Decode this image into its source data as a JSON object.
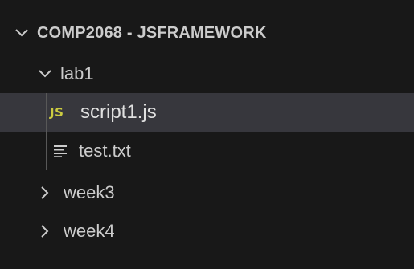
{
  "explorer": {
    "root": {
      "label": "COMP2068 - JSFRAMEWORK",
      "expanded": true,
      "icon": "chevron-down-icon"
    },
    "folder_lab1": {
      "label": "lab1",
      "expanded": true,
      "icon": "chevron-down-icon"
    },
    "file_script": {
      "label": "script1.js",
      "icon_text": "JS",
      "icon": "javascript-file-icon",
      "icon_color": "#cbcb41",
      "selected": true
    },
    "file_test": {
      "label": "test.txt",
      "icon": "text-file-icon"
    },
    "folder_week3": {
      "label": "week3",
      "expanded": false,
      "icon": "chevron-right-icon"
    },
    "folder_week4": {
      "label": "week4",
      "expanded": false,
      "icon": "chevron-right-icon"
    }
  },
  "colors": {
    "background": "#181818",
    "selected_row": "#37373d",
    "text": "#cccccc",
    "js_icon": "#cbcb41",
    "indent_guide": "#585858"
  }
}
